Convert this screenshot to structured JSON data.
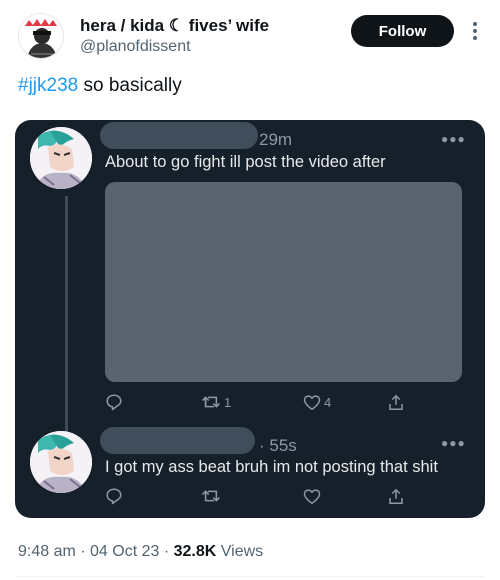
{
  "header": {
    "display_name": "hera / kida ☾ fives’ wife",
    "handle": "@planofdissent",
    "follow_label": "Follow"
  },
  "tweet": {
    "hashtag": "#jjk238",
    "text": " so basically"
  },
  "screenshot": {
    "message1": {
      "time": "29m",
      "text": "About to go fight ill post the video after",
      "retweets": "1",
      "likes": "4"
    },
    "message2": {
      "time": "55s",
      "text": "I got my ass beat bruh im not posting that shit"
    }
  },
  "meta": {
    "time": "9:48 am",
    "sep": " · ",
    "date": "04 Oct 23",
    "views_count": "32.8K",
    "views_label": " Views"
  },
  "colors": {
    "accent": "#1d9bf0",
    "card_bg": "#15202b",
    "follow_bg": "#0f1419"
  },
  "icons": [
    "avatar-icon",
    "more-vertical-icon",
    "reply-icon",
    "retweet-icon",
    "like-icon",
    "share-icon",
    "more-horizontal-icon"
  ]
}
